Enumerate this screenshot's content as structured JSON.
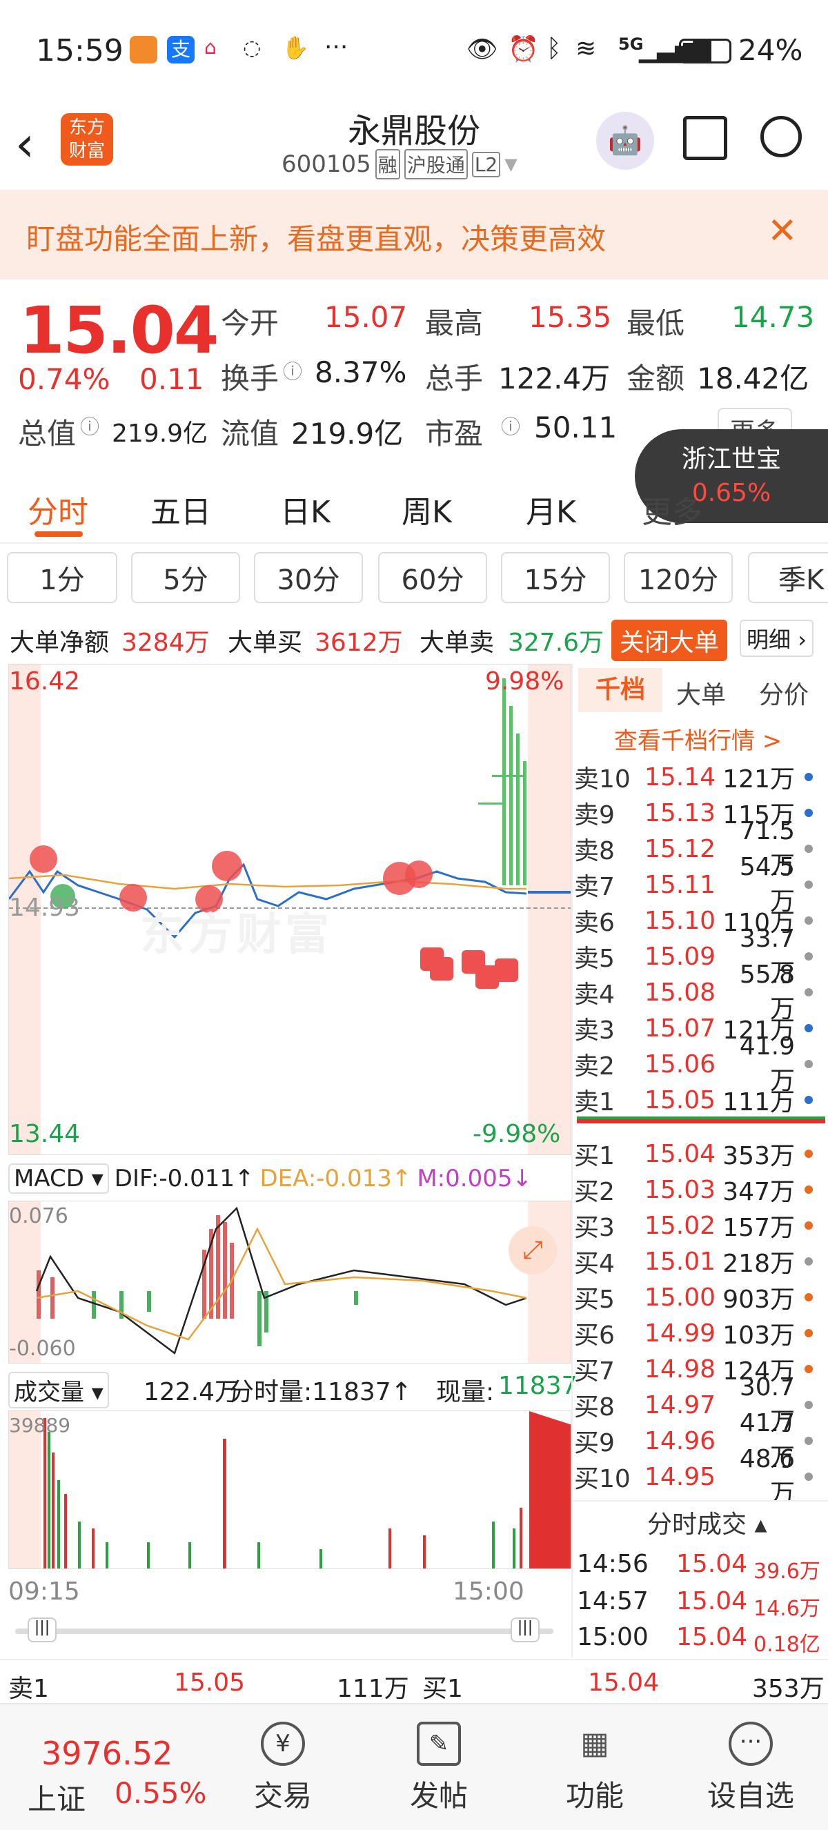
{
  "status_bar": {
    "time": "15:59",
    "battery": "24%",
    "network": "5G"
  },
  "header": {
    "title": "永鼎股份",
    "code": "600105",
    "tags": [
      "融",
      "沪股通",
      "L2"
    ],
    "logo_text": "东方财富"
  },
  "banner": {
    "text": "盯盘功能全面上新，看盘更直观，决策更高效"
  },
  "quote": {
    "price": "15.04",
    "change_pct": "0.74%",
    "change": "0.11",
    "stats": [
      {
        "label": "今开",
        "value": "15.07"
      },
      {
        "label": "最高",
        "value": "15.35"
      },
      {
        "label": "最低",
        "value": "14.73"
      },
      {
        "label": "换手",
        "value": "8.37%"
      },
      {
        "label": "总手",
        "value": "122.4万"
      },
      {
        "label": "金额",
        "value": "18.42亿"
      },
      {
        "label": "总值",
        "value": "219.9亿"
      },
      {
        "label": "流值",
        "value": "219.9亿"
      },
      {
        "label": "市盈",
        "value": "50.11"
      }
    ],
    "more": "更多"
  },
  "float_card": {
    "name": "浙江世宝",
    "pct": "0.65%"
  },
  "chart_tabs": [
    "分时",
    "五日",
    "日K",
    "周K",
    "月K",
    "更多"
  ],
  "periods": [
    "1分",
    "5分",
    "30分",
    "60分",
    "15分",
    "120分",
    "季K"
  ],
  "big_orders": {
    "net_label": "大单净额",
    "net": "3284万",
    "buy_label": "大单买",
    "buy": "3612万",
    "sell_label": "大单卖",
    "sell": "327.6万",
    "toggle": "关闭大单",
    "detail": "明细"
  },
  "intraday": {
    "y_high": "16.42",
    "y_low": "13.44",
    "y_mid": "14.93",
    "pct_high": "9.98%",
    "pct_low": "-9.98%",
    "watermark": "东方财富"
  },
  "macd": {
    "label": "MACD",
    "dif": "DIF:-0.011↑",
    "dea": "DEA:-0.013↑",
    "m": "M:0.005↓",
    "top": "0.076",
    "bottom": "-0.060"
  },
  "volume": {
    "label": "成交量",
    "total": "122.4万",
    "fen_label": "分时量:11837↑",
    "now_label": "现量:",
    "now": "11837",
    "max": "39889",
    "t_start": "09:15",
    "t_end": "15:00"
  },
  "orderbook": {
    "tabs": [
      "千档",
      "大单",
      "分价"
    ],
    "link": "查看千档行情 >",
    "asks": [
      {
        "l": "卖10",
        "p": "15.14",
        "v": "121万",
        "c": "#2c6fc8"
      },
      {
        "l": "卖9",
        "p": "15.13",
        "v": "115万",
        "c": "#2c6fc8"
      },
      {
        "l": "卖8",
        "p": "15.12",
        "v": "71.5万",
        "c": "#999999"
      },
      {
        "l": "卖7",
        "p": "15.11",
        "v": "54.5万",
        "c": "#999999"
      },
      {
        "l": "卖6",
        "p": "15.10",
        "v": "110万",
        "c": "#999999"
      },
      {
        "l": "卖5",
        "p": "15.09",
        "v": "33.7万",
        "c": "#999999"
      },
      {
        "l": "卖4",
        "p": "15.08",
        "v": "55.8万",
        "c": "#999999"
      },
      {
        "l": "卖3",
        "p": "15.07",
        "v": "121万",
        "c": "#2c6fc8"
      },
      {
        "l": "卖2",
        "p": "15.06",
        "v": "41.9万",
        "c": "#999999"
      },
      {
        "l": "卖1",
        "p": "15.05",
        "v": "111万",
        "c": "#2c6fc8"
      }
    ],
    "bids": [
      {
        "l": "买1",
        "p": "15.04",
        "v": "353万",
        "c": "#e66b20"
      },
      {
        "l": "买2",
        "p": "15.03",
        "v": "347万",
        "c": "#e66b20"
      },
      {
        "l": "买3",
        "p": "15.02",
        "v": "157万",
        "c": "#e66b20"
      },
      {
        "l": "买4",
        "p": "15.01",
        "v": "218万",
        "c": "#999999"
      },
      {
        "l": "买5",
        "p": "15.00",
        "v": "903万",
        "c": "#e66b20"
      },
      {
        "l": "买6",
        "p": "14.99",
        "v": "103万",
        "c": "#e66b20"
      },
      {
        "l": "买7",
        "p": "14.98",
        "v": "124万",
        "c": "#e66b20"
      },
      {
        "l": "买8",
        "p": "14.97",
        "v": "30.7万",
        "c": "#999999"
      },
      {
        "l": "买9",
        "p": "14.96",
        "v": "41.7万",
        "c": "#999999"
      },
      {
        "l": "买10",
        "p": "14.95",
        "v": "48.6万",
        "c": "#999999"
      }
    ],
    "ticks_title": "分时成交",
    "ticks": [
      {
        "t": "14:56",
        "p": "15.04",
        "v": "39.6万"
      },
      {
        "t": "14:57",
        "p": "15.04",
        "v": "14.6万"
      },
      {
        "t": "15:00",
        "p": "15.04",
        "v": "0.18亿"
      }
    ]
  },
  "bottom_quote": {
    "sell_label": "卖1",
    "sell_price": "15.05",
    "sell_vol": "111万",
    "buy_label": "买1",
    "buy_price": "15.04",
    "buy_vol": "353万"
  },
  "bottom_nav": {
    "index_value": "3976.52",
    "index_name": "上证",
    "index_pct": "0.55%",
    "items": [
      "交易",
      "发帖",
      "功能",
      "设自选"
    ]
  }
}
